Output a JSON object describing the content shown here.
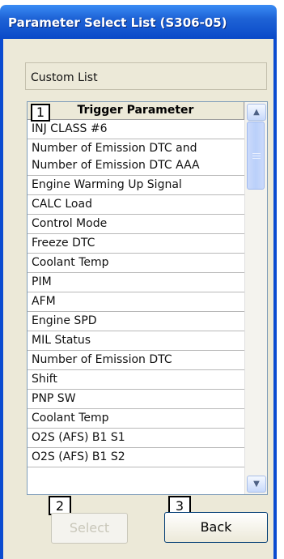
{
  "window": {
    "title": "Parameter Select List (S306-05)"
  },
  "custom_list_label": "Custom List",
  "list": {
    "header": "Trigger Parameter",
    "items": [
      "INJ CLASS #6",
      "Number of Emission DTC and Number of Emission DTC AAA",
      "Engine Warming Up Signal",
      "CALC Load",
      "Control Mode",
      "Freeze DTC",
      "Coolant Temp",
      "PIM",
      "AFM",
      "Engine SPD",
      "MIL Status",
      "Number of Emission DTC",
      "Shift",
      "PNP SW",
      "Coolant Temp",
      "O2S (AFS) B1 S1",
      "O2S (AFS) B1 S2"
    ]
  },
  "callouts": {
    "list": "1",
    "select": "2",
    "back": "3"
  },
  "buttons": {
    "select_label": "Select",
    "back_label": "Back"
  },
  "icons": {
    "scroll_up": "scroll-up-arrow-icon",
    "scroll_down": "scroll-down-arrow-icon"
  },
  "colors": {
    "title_bar": "#0a49c8",
    "window_bg": "#ece9d8"
  }
}
